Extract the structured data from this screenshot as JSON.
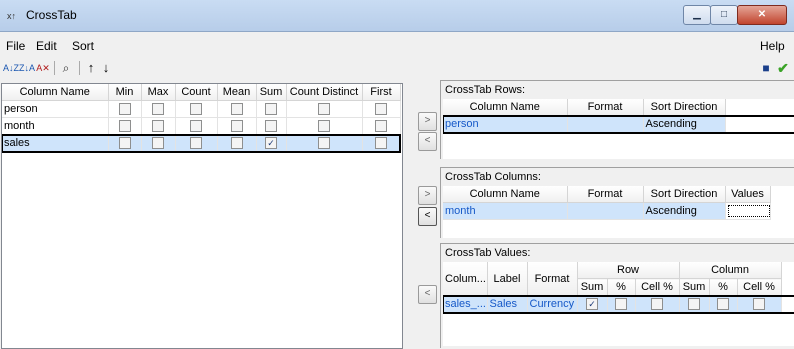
{
  "window": {
    "title": "CrossTab"
  },
  "menu": {
    "file": "File",
    "edit": "Edit",
    "sort": "Sort",
    "help": "Help"
  },
  "left_grid": {
    "headers": [
      "Column Name",
      "Min",
      "Max",
      "Count",
      "Mean",
      "Sum",
      "Count Distinct",
      "First"
    ],
    "rows": [
      {
        "name": "person",
        "checks": [
          false,
          false,
          false,
          false,
          false,
          false,
          false
        ],
        "selected": false
      },
      {
        "name": "month",
        "checks": [
          false,
          false,
          false,
          false,
          false,
          false,
          false
        ],
        "selected": false
      },
      {
        "name": "sales",
        "checks": [
          false,
          false,
          false,
          false,
          true,
          false,
          false
        ],
        "selected": true
      }
    ]
  },
  "rows_section": {
    "title": "CrossTab Rows:",
    "headers": [
      "Column Name",
      "Format",
      "Sort Direction"
    ],
    "rows": [
      {
        "name": "person",
        "format": "",
        "sort": "Ascending"
      }
    ]
  },
  "columns_section": {
    "title": "CrossTab Columns:",
    "headers": [
      "Column Name",
      "Format",
      "Sort Direction",
      "Values"
    ],
    "rows": [
      {
        "name": "month",
        "format": "",
        "sort": "Ascending",
        "values": ""
      }
    ]
  },
  "values_section": {
    "title": "CrossTab Values:",
    "headers": [
      "Colum...",
      "Label",
      "Format",
      "Row",
      "Column"
    ],
    "subheaders": [
      "Sum",
      "%",
      "Cell %",
      "Sum",
      "%",
      "Cell %"
    ],
    "rows": [
      {
        "column": "sales_...",
        "label": "Sales",
        "format": "Currency",
        "checks": [
          true,
          false,
          false,
          false,
          false,
          false
        ]
      }
    ]
  },
  "move_buttons": {
    "right": ">",
    "left": "<"
  },
  "icons": {
    "app": "crosstab-app-icon",
    "sort_asc": "sort-ascending-icon",
    "sort_desc": "sort-descending-icon",
    "clear_sort": "clear-sort-icon",
    "find": "binoculars-icon",
    "up": "arrow-up-icon",
    "down": "arrow-down-icon",
    "save": "save-icon",
    "ok": "checkmark-icon",
    "close": "close-icon",
    "minimize": "minimize-icon",
    "maximize": "maximize-icon"
  },
  "colors": {
    "selection": "#cfe4fb",
    "link_text": "#1659c8",
    "ok_green": "#3aa327"
  }
}
